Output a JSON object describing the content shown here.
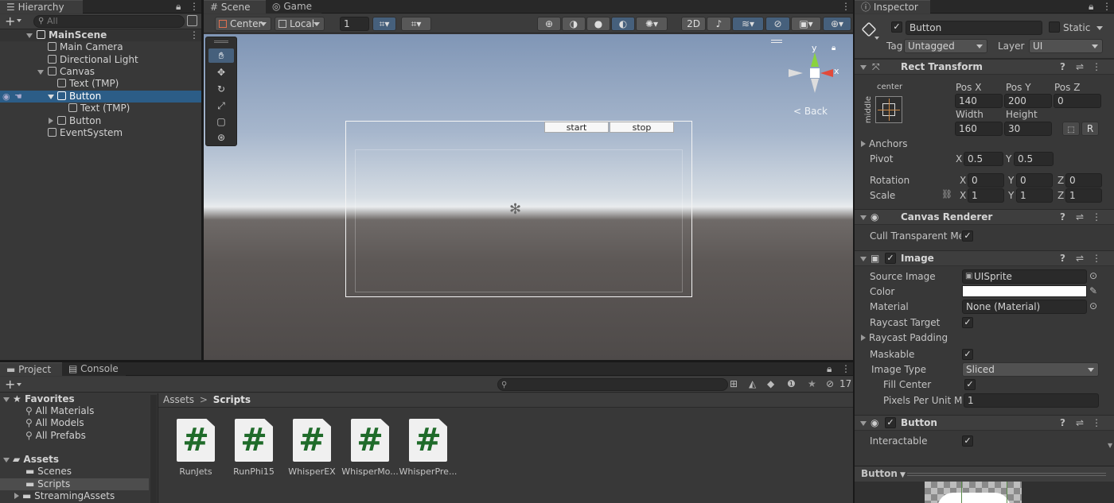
{
  "hierarchy": {
    "tab_label": "Hierarchy",
    "search_placeholder": "All",
    "items": [
      {
        "label": "MainScene",
        "depth": 0
      },
      {
        "label": "Main Camera",
        "depth": 1
      },
      {
        "label": "Directional Light",
        "depth": 1
      },
      {
        "label": "Canvas",
        "depth": 1
      },
      {
        "label": "Text (TMP)",
        "depth": 2
      },
      {
        "label": "Button",
        "depth": 2
      },
      {
        "label": "Text (TMP)",
        "depth": 3
      },
      {
        "label": "Button",
        "depth": 2
      },
      {
        "label": "EventSystem",
        "depth": 1
      }
    ]
  },
  "scene": {
    "tab_scene": "Scene",
    "tab_game": "Game",
    "pivot_mode": "Center",
    "space_mode": "Local",
    "grid_value": "1",
    "btn_2d": "2D",
    "back_label": "< Back",
    "gizmo_y": "y",
    "gizmo_x": "x",
    "game_buttons": [
      "start",
      "stop"
    ]
  },
  "project": {
    "tab_project": "Project",
    "tab_console": "Console",
    "hidden_count": "17",
    "favorites_label": "Favorites",
    "favorites": [
      "All Materials",
      "All Models",
      "All Prefabs"
    ],
    "assets_label": "Assets",
    "folders": [
      "Scenes",
      "Scripts",
      "StreamingAssets"
    ],
    "breadcrumb_root": "Assets",
    "breadcrumb_sep": ">",
    "breadcrumb_current": "Scripts",
    "scripts": [
      "RunJets",
      "RunPhi15",
      "WhisperEX",
      "WhisperMo...",
      "WhisperPre..."
    ],
    "script_glyph": "#"
  },
  "inspector": {
    "tab_label": "Inspector",
    "object_name": "Button",
    "static_label": "Static",
    "tag_label": "Tag",
    "tag_value": "Untagged",
    "layer_label": "Layer",
    "layer_value": "UI",
    "rect_transform": {
      "title": "Rect Transform",
      "anchor_h": "center",
      "anchor_v": "middle",
      "posx_label": "Pos X",
      "posx": "140",
      "posy_label": "Pos Y",
      "posy": "200",
      "posz_label": "Pos Z",
      "posz": "0",
      "width_label": "Width",
      "width": "160",
      "height_label": "Height",
      "height": "30",
      "r_label": "R",
      "anchors_label": "Anchors",
      "pivot_label": "Pivot",
      "pivot_x": "0.5",
      "pivot_y": "0.5",
      "rotation_label": "Rotation",
      "rot_x": "0",
      "rot_y": "0",
      "rot_z": "0",
      "scale_label": "Scale",
      "scale_x": "1",
      "scale_y": "1",
      "scale_z": "1",
      "x": "X",
      "y": "Y",
      "z": "Z"
    },
    "canvas_renderer": {
      "title": "Canvas Renderer",
      "cull_label": "Cull Transparent Mes"
    },
    "image": {
      "title": "Image",
      "source_label": "Source Image",
      "source_value": "UISprite",
      "color_label": "Color",
      "material_label": "Material",
      "material_value": "None (Material)",
      "raycast_target_label": "Raycast Target",
      "raycast_padding_label": "Raycast Padding",
      "maskable_label": "Maskable",
      "image_type_label": "Image Type",
      "image_type_value": "Sliced",
      "fill_center_label": "Fill Center",
      "ppu_label": "Pixels Per Unit Mu",
      "ppu_value": "1"
    },
    "button": {
      "title": "Button",
      "interactable_label": "Interactable"
    },
    "preview_label": "Button"
  },
  "colors": {
    "selection": "#2c5d87",
    "accent": "#46607c",
    "script_hash": "#1f6b2a"
  }
}
